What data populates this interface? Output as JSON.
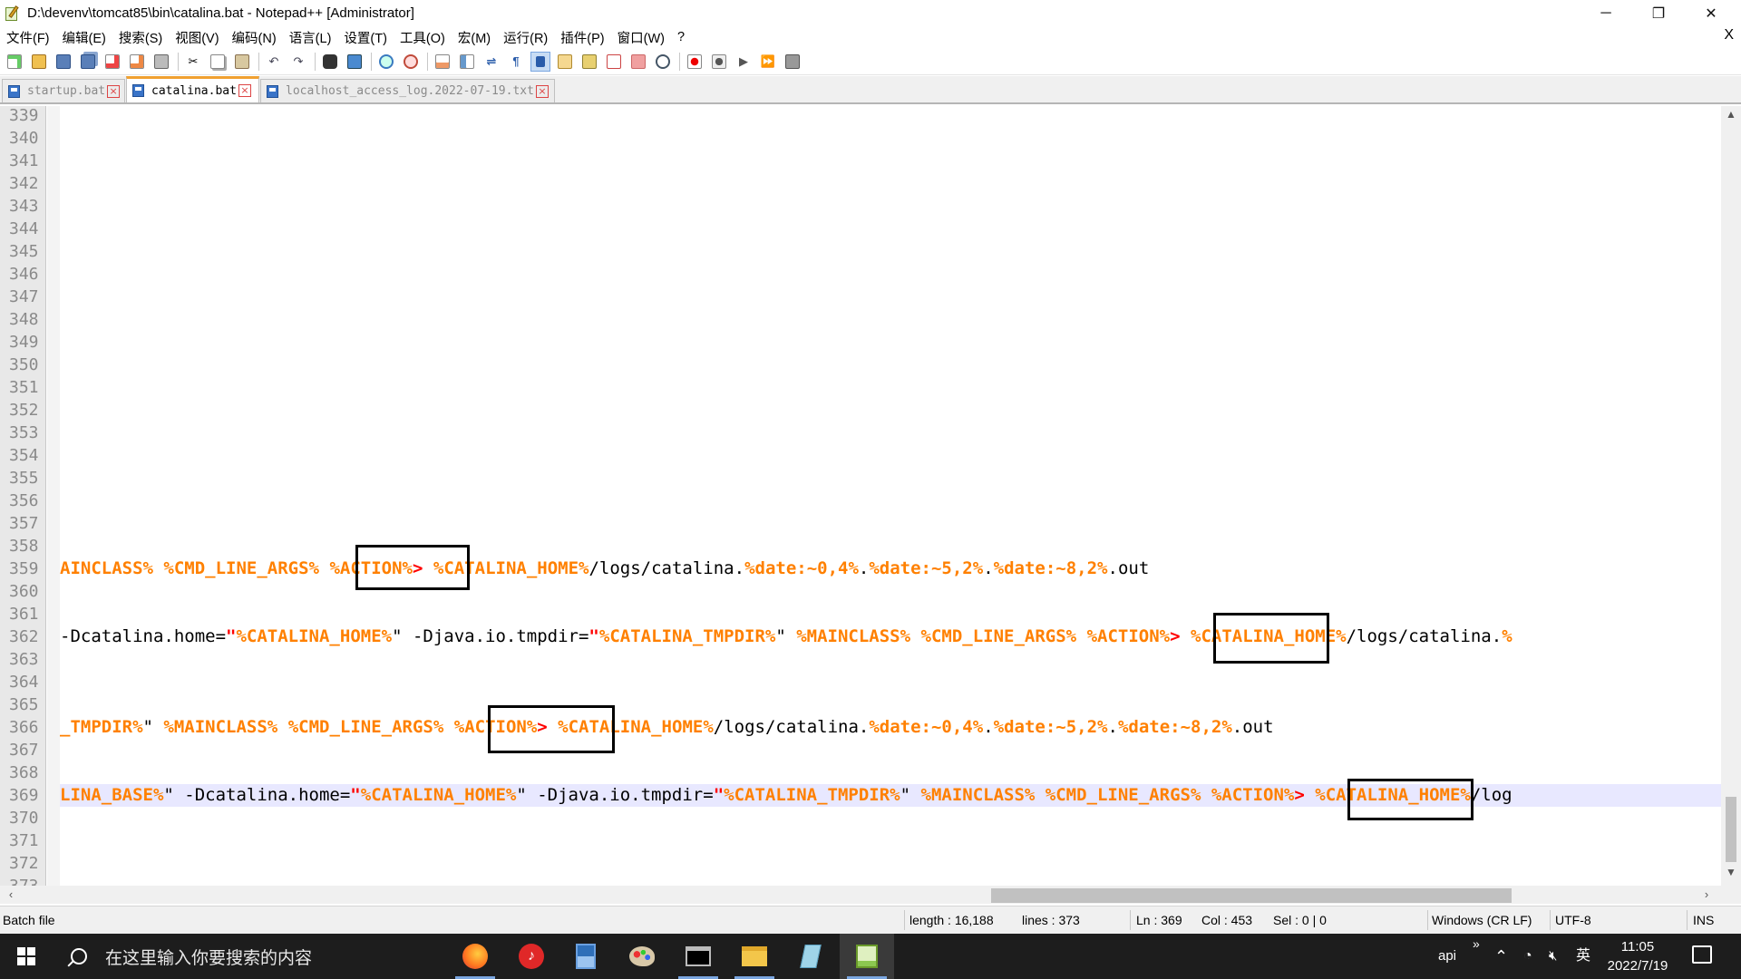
{
  "window": {
    "title": "D:\\devenv\\tomcat85\\bin\\catalina.bat - Notepad++ [Administrator]",
    "controls": {
      "minimize": "─",
      "maximize": "❐",
      "close": "✕"
    }
  },
  "menu": [
    "文件(F)",
    "编辑(E)",
    "搜索(S)",
    "视图(V)",
    "编码(N)",
    "语言(L)",
    "设置(T)",
    "工具(O)",
    "宏(M)",
    "运行(R)",
    "插件(P)",
    "窗口(W)",
    "?"
  ],
  "menu_close": "X",
  "tabs": [
    {
      "label": "startup.bat",
      "active": false
    },
    {
      "label": "catalina.bat",
      "active": true
    },
    {
      "label": "localhost_access_log.2022-07-19.txt",
      "active": false
    }
  ],
  "editor": {
    "line_numbers": [
      "339",
      "340",
      "341",
      "342",
      "343",
      "344",
      "345",
      "346",
      "347",
      "348",
      "349",
      "350",
      "351",
      "352",
      "353",
      "354",
      "355",
      "356",
      "357",
      "358",
      "359",
      "360",
      "361",
      "362",
      "363",
      "364",
      "365",
      "366",
      "367",
      "368",
      "369",
      "370",
      "371",
      "372",
      "373"
    ],
    "current_line": "369",
    "lines": {
      "359": [
        {
          "t": "v",
          "s": "AINCLASS%"
        },
        {
          "t": "n",
          "s": " "
        },
        {
          "t": "v",
          "s": "%CMD_LINE_ARGS%"
        },
        {
          "t": "n",
          "s": " "
        },
        {
          "t": "v",
          "s": "%ACTION%"
        },
        {
          "t": "r",
          "s": ">"
        },
        {
          "t": "n",
          "s": " "
        },
        {
          "t": "v",
          "s": "%CATALINA_HOME%"
        },
        {
          "t": "n",
          "s": "/logs/catalina."
        },
        {
          "t": "v",
          "s": "%date:~0,4%"
        },
        {
          "t": "n",
          "s": "."
        },
        {
          "t": "v",
          "s": "%date:~5,2%"
        },
        {
          "t": "n",
          "s": "."
        },
        {
          "t": "v",
          "s": "%date:~8,2%"
        },
        {
          "t": "n",
          "s": ".out"
        }
      ],
      "362": [
        {
          "t": "n",
          "s": "-Dcatalina.home="
        },
        {
          "t": "r",
          "s": "\""
        },
        {
          "t": "v",
          "s": "%CATALINA_HOME%"
        },
        {
          "t": "n",
          "s": "\" -Djava.io.tmpdir="
        },
        {
          "t": "r",
          "s": "\""
        },
        {
          "t": "v",
          "s": "%CATALINA_TMPDIR%"
        },
        {
          "t": "n",
          "s": "\" "
        },
        {
          "t": "v",
          "s": "%MAINCLASS%"
        },
        {
          "t": "n",
          "s": " "
        },
        {
          "t": "v",
          "s": "%CMD_LINE_ARGS%"
        },
        {
          "t": "n",
          "s": " "
        },
        {
          "t": "v",
          "s": "%ACTION%"
        },
        {
          "t": "r",
          "s": ">"
        },
        {
          "t": "n",
          "s": " "
        },
        {
          "t": "v",
          "s": "%CATALINA_HOME%"
        },
        {
          "t": "n",
          "s": "/logs/catalina."
        },
        {
          "t": "v",
          "s": "%"
        }
      ],
      "366": [
        {
          "t": "v",
          "s": "_TMPDIR%"
        },
        {
          "t": "n",
          "s": "\" "
        },
        {
          "t": "v",
          "s": "%MAINCLASS%"
        },
        {
          "t": "n",
          "s": " "
        },
        {
          "t": "v",
          "s": "%CMD_LINE_ARGS%"
        },
        {
          "t": "n",
          "s": " "
        },
        {
          "t": "v",
          "s": "%ACTION%"
        },
        {
          "t": "r",
          "s": ">"
        },
        {
          "t": "n",
          "s": " "
        },
        {
          "t": "v",
          "s": "%CATALINA_HOME%"
        },
        {
          "t": "n",
          "s": "/logs/catalina."
        },
        {
          "t": "v",
          "s": "%date:~0,4%"
        },
        {
          "t": "n",
          "s": "."
        },
        {
          "t": "v",
          "s": "%date:~5,2%"
        },
        {
          "t": "n",
          "s": "."
        },
        {
          "t": "v",
          "s": "%date:~8,2%"
        },
        {
          "t": "n",
          "s": ".out"
        }
      ],
      "369": [
        {
          "t": "v",
          "s": "LINA_BASE%"
        },
        {
          "t": "n",
          "s": "\" -Dcatalina.home="
        },
        {
          "t": "r",
          "s": "\""
        },
        {
          "t": "v",
          "s": "%CATALINA_HOME%"
        },
        {
          "t": "n",
          "s": "\" -Djava.io.tmpdir="
        },
        {
          "t": "r",
          "s": "\""
        },
        {
          "t": "v",
          "s": "%CATALINA_TMPDIR%"
        },
        {
          "t": "n",
          "s": "\" "
        },
        {
          "t": "v",
          "s": "%MAINCLASS%"
        },
        {
          "t": "n",
          "s": " "
        },
        {
          "t": "v",
          "s": "%CMD_LINE_ARGS%"
        },
        {
          "t": "n",
          "s": " "
        },
        {
          "t": "v",
          "s": "%ACTION%"
        },
        {
          "t": "r",
          "s": ">"
        },
        {
          "t": "n",
          "s": " "
        },
        {
          "t": "v",
          "s": "%CATALINA_HOME%"
        },
        {
          "t": "n",
          "s": "/log"
        }
      ]
    }
  },
  "statusbar": {
    "file_type": "Batch file",
    "length": "length : 16,188",
    "lines": "lines : 373",
    "ln": "Ln : 369",
    "col": "Col : 453",
    "sel": "Sel : 0 | 0",
    "eol": "Windows (CR LF)",
    "encoding": "UTF-8",
    "mode": "INS"
  },
  "taskbar": {
    "search_placeholder": "在这里输入你要搜索的内容",
    "tray_label": "api",
    "tray_chevron": "»",
    "ime": "英",
    "time": "11:05",
    "date": "2022/7/19"
  },
  "colors": {
    "variable": "#ff8000",
    "operator": "#ff0000",
    "current_line_bg": "#e8e8ff",
    "tab_accent": "#f0a030"
  }
}
